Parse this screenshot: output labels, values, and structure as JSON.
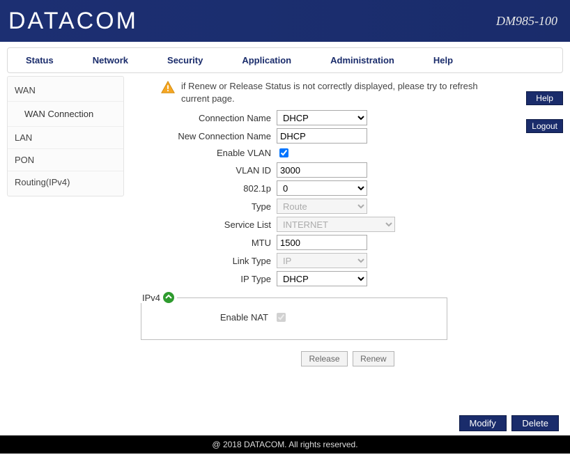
{
  "header": {
    "brand": "DATACOM",
    "model": "DM985-100"
  },
  "topnav": {
    "status": "Status",
    "network": "Network",
    "security": "Security",
    "application": "Application",
    "administration": "Administration",
    "help": "Help"
  },
  "sidebar": {
    "wan": "WAN",
    "wan_connection": "WAN Connection",
    "lan": "LAN",
    "pon": "PON",
    "routing": "Routing(IPv4)"
  },
  "sideButtons": {
    "help": "Help",
    "logout": "Logout"
  },
  "warning": "if Renew or Release Status is not correctly displayed, please try to refresh current page.",
  "form": {
    "connection_name": {
      "label": "Connection Name",
      "value": "DHCP"
    },
    "new_connection_name": {
      "label": "New Connection Name",
      "value": "DHCP"
    },
    "enable_vlan": {
      "label": "Enable VLAN"
    },
    "vlan_id": {
      "label": "VLAN ID",
      "value": "3000"
    },
    "dot1p": {
      "label": "802.1p",
      "value": "0"
    },
    "type": {
      "label": "Type",
      "value": "Route"
    },
    "service_list": {
      "label": "Service List",
      "value": "INTERNET"
    },
    "mtu": {
      "label": "MTU",
      "value": "1500"
    },
    "link_type": {
      "label": "Link Type",
      "value": "IP"
    },
    "ip_type": {
      "label": "IP Type",
      "value": "DHCP"
    }
  },
  "ipv4": {
    "legend": "IPv4",
    "enable_nat": "Enable NAT"
  },
  "buttons": {
    "release": "Release",
    "renew": "Renew",
    "modify": "Modify",
    "delete": "Delete"
  },
  "footer": "@ 2018 DATACOM. All rights reserved."
}
